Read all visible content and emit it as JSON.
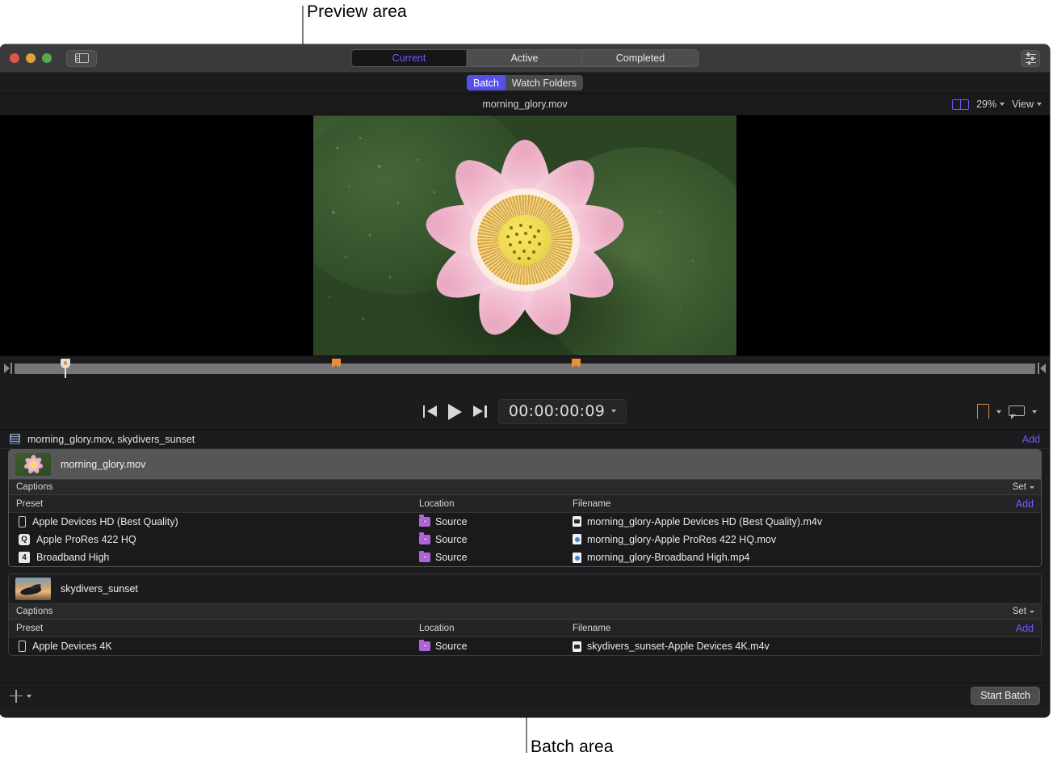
{
  "annotations": {
    "preview_area": "Preview area",
    "batch_area": "Batch area"
  },
  "titlebar": {
    "sidebar_toggle": "sidebar-toggle",
    "segments": [
      {
        "label": "Current",
        "active": true
      },
      {
        "label": "Active",
        "active": false
      },
      {
        "label": "Completed",
        "active": false
      }
    ],
    "settings_icon": "sliders-icon"
  },
  "subtoolbar": {
    "segments": [
      {
        "label": "Batch",
        "active": true
      },
      {
        "label": "Watch Folders",
        "active": false
      }
    ]
  },
  "preview_header": {
    "title": "morning_glory.mov",
    "split_icon": "split-view-icon",
    "zoom": "29%",
    "view": "View"
  },
  "transport": {
    "prev_icon": "skip-previous-icon",
    "play_icon": "play-icon",
    "next_icon": "skip-next-icon",
    "timecode": "00:00:00:09",
    "bookmark_icon": "bookmark-icon",
    "caption_icon": "caption-bubble-icon"
  },
  "scrubber": {
    "playhead_percent": 5.0,
    "markers_percent": [
      5.0,
      31.5,
      55.0
    ]
  },
  "batch": {
    "header_title": "morning_glory.mov, skydivers_sunset",
    "header_add": "Add",
    "columns": {
      "preset": "Preset",
      "location": "Location",
      "filename": "Filename",
      "add": "Add"
    },
    "captions_label": "Captions",
    "captions_set": "Set",
    "jobs": [
      {
        "name": "morning_glory.mov",
        "selected": true,
        "thumb": "flower-thumbnail",
        "rows": [
          {
            "preset": "Apple Devices HD (Best Quality)",
            "preset_icon": "phone-icon",
            "location": "Source",
            "location_icon": "purple-folder-icon",
            "filename": "morning_glory-Apple Devices HD (Best Quality).m4v",
            "file_icon": "m4v-document-icon"
          },
          {
            "preset": "Apple ProRes 422 HQ",
            "preset_icon": "prores-badge-icon",
            "location": "Source",
            "location_icon": "purple-folder-icon",
            "filename": "morning_glory-Apple ProRes 422 HQ.mov",
            "file_icon": "mov-document-icon"
          },
          {
            "preset": "Broadband High",
            "preset_icon": "number-4-badge-icon",
            "location": "Source",
            "location_icon": "purple-folder-icon",
            "filename": "morning_glory-Broadband High.mp4",
            "file_icon": "mp4-document-icon"
          }
        ]
      },
      {
        "name": "skydivers_sunset",
        "selected": false,
        "thumb": "skydivers-thumbnail",
        "rows": [
          {
            "preset": "Apple Devices 4K",
            "preset_icon": "phone-icon",
            "location": "Source",
            "location_icon": "purple-folder-icon",
            "filename": "skydivers_sunset-Apple Devices 4K.m4v",
            "file_icon": "m4v-document-icon"
          }
        ]
      }
    ]
  },
  "bottombar": {
    "add_icon": "plus-icon",
    "start_batch": "Start Batch"
  },
  "colors": {
    "accent_blue": "#6b5cff",
    "batch_badge": "#5650e8",
    "marker_orange": "#e89037",
    "folder_purple": "#b064d8",
    "window_bg": "#1c1c1e",
    "titlebar_bg": "#3a3a3c"
  }
}
